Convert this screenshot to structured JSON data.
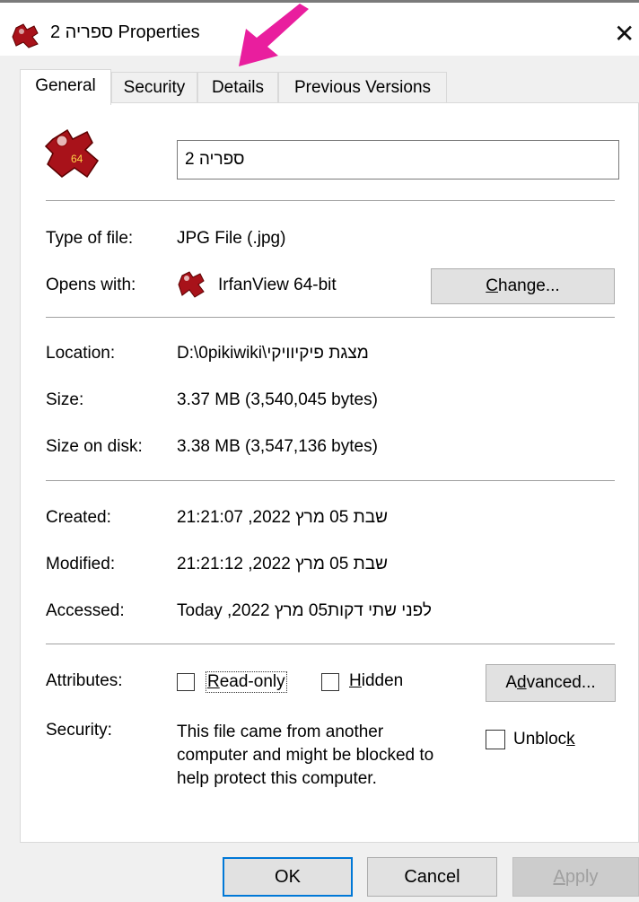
{
  "window": {
    "title": "ספריה 2 Properties",
    "close_glyph": "✕",
    "annotation_arrow_color": "#e91e9e"
  },
  "tabs": [
    {
      "label": "General",
      "active": true
    },
    {
      "label": "Security",
      "active": false
    },
    {
      "label": "Details",
      "active": false
    },
    {
      "label": "Previous Versions",
      "active": false
    }
  ],
  "general": {
    "file_icon": "irfanview-file-icon",
    "file_icon_badge": "64",
    "file_name": "ספריה 2",
    "type_label": "Type of file:",
    "type_value": "JPG File (.jpg)",
    "opens_label": "Opens with:",
    "opens_value": "IrfanView 64-bit",
    "change_pre": "",
    "change_u": "C",
    "change_post": "hange...",
    "location_label": "Location:",
    "location_value": "D:\\0pikiwiki\\מצגת פיקיוויקי",
    "size_label": "Size:",
    "size_value": "3.37 MB (3,540,045 bytes)",
    "size_disk_label": "Size on disk:",
    "size_disk_value": "3.38 MB (3,547,136 bytes)",
    "created_label": "Created:",
    "created_value": "שבת 05 מרץ 2022, 21:21:07",
    "modified_label": "Modified:",
    "modified_value": "שבת 05 מרץ 2022, 21:21:12",
    "accessed_label": "Accessed:",
    "accessed_value": "Today  ,2022 לפני שתי דקות05 מרץ",
    "attributes_label": "Attributes:",
    "readonly_u": "R",
    "readonly_post": "ead-only",
    "hidden_u": "H",
    "hidden_post": "idden",
    "readonly_checked": false,
    "hidden_checked": false,
    "advanced_pre": "A",
    "advanced_u": "d",
    "advanced_post": "vanced...",
    "security_label": "Security:",
    "security_text_1": "This file came from another",
    "security_text_2": "computer and might be blocked to",
    "security_text_3": "help protect this computer.",
    "unblock_pre": "Unbloc",
    "unblock_u": "k",
    "unblock_checked": false
  },
  "footer": {
    "ok": "OK",
    "cancel": "Cancel",
    "apply_u": "A",
    "apply_post": "pply"
  }
}
